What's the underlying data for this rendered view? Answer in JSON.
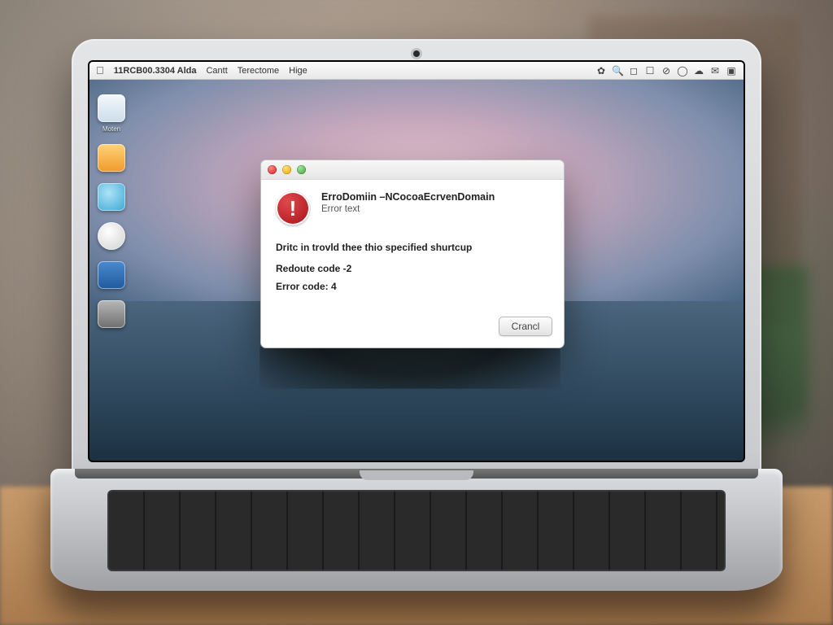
{
  "menubar": {
    "app_title": "11RCB00.3304 Alda",
    "items": [
      "Cantt",
      "Terectome",
      "Hige"
    ]
  },
  "desktop": {
    "icon_label": "Moten",
    "icon_colors": [
      "#dfe8ef",
      "#ffb547",
      "#6ec1e4",
      "#e7e7e7",
      "#2e6db4",
      "#8a8a8a"
    ]
  },
  "dialog": {
    "heading": "ErroDomiin –NCocoaEcrvenDomain",
    "subheading": "Error text",
    "message": "Dritc in trovld thee thio specified shurtcup",
    "line2": "Redoute code -2",
    "line3": "Error code: 4",
    "button": "Crancl"
  }
}
